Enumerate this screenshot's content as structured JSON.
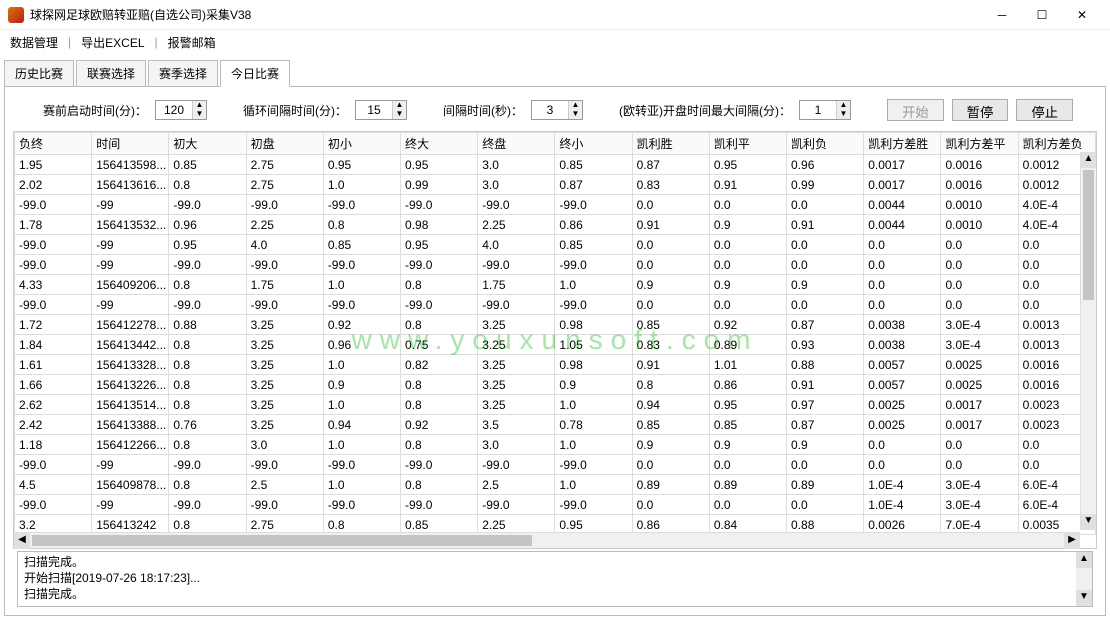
{
  "window": {
    "title": "球探网足球欧赔转亚赔(自选公司)采集V38"
  },
  "menu": {
    "items": [
      "数据管理",
      "导出EXCEL",
      "报警邮箱"
    ]
  },
  "tabs": {
    "items": [
      "历史比赛",
      "联赛选择",
      "赛季选择",
      "今日比赛"
    ],
    "active": 3
  },
  "controls": {
    "label1": "赛前启动时间(分)：",
    "spin1": "120",
    "label2": "循环间隔时间(分)：",
    "spin2": "15",
    "label3": "间隔时间(秒)：",
    "spin3": "3",
    "label4": "(欧转亚)开盘时间最大间隔(分)：",
    "spin4": "1",
    "btn_start": "开始",
    "btn_pause": "暂停",
    "btn_stop": "停止"
  },
  "table": {
    "headers": [
      "负终",
      "时间",
      "初大",
      "初盘",
      "初小",
      "终大",
      "终盘",
      "终小",
      "凯利胜",
      "凯利平",
      "凯利负",
      "凯利方差胜",
      "凯利方差平",
      "凯利方差负"
    ],
    "rows": [
      [
        "1.95",
        "156413598...",
        "0.85",
        "2.75",
        "0.95",
        "0.95",
        "3.0",
        "0.85",
        "0.87",
        "0.95",
        "0.96",
        "0.0017",
        "0.0016",
        "0.0012"
      ],
      [
        "2.02",
        "156413616...",
        "0.8",
        "2.75",
        "1.0",
        "0.99",
        "3.0",
        "0.87",
        "0.83",
        "0.91",
        "0.99",
        "0.0017",
        "0.0016",
        "0.0012"
      ],
      [
        "-99.0",
        "-99",
        "-99.0",
        "-99.0",
        "-99.0",
        "-99.0",
        "-99.0",
        "-99.0",
        "0.0",
        "0.0",
        "0.0",
        "0.0044",
        "0.0010",
        "4.0E-4"
      ],
      [
        "1.78",
        "156413532...",
        "0.96",
        "2.25",
        "0.8",
        "0.98",
        "2.25",
        "0.86",
        "0.91",
        "0.9",
        "0.91",
        "0.0044",
        "0.0010",
        "4.0E-4"
      ],
      [
        "-99.0",
        "-99",
        "0.95",
        "4.0",
        "0.85",
        "0.95",
        "4.0",
        "0.85",
        "0.0",
        "0.0",
        "0.0",
        "0.0",
        "0.0",
        "0.0"
      ],
      [
        "-99.0",
        "-99",
        "-99.0",
        "-99.0",
        "-99.0",
        "-99.0",
        "-99.0",
        "-99.0",
        "0.0",
        "0.0",
        "0.0",
        "0.0",
        "0.0",
        "0.0"
      ],
      [
        "4.33",
        "156409206...",
        "0.8",
        "1.75",
        "1.0",
        "0.8",
        "1.75",
        "1.0",
        "0.9",
        "0.9",
        "0.9",
        "0.0",
        "0.0",
        "0.0"
      ],
      [
        "-99.0",
        "-99",
        "-99.0",
        "-99.0",
        "-99.0",
        "-99.0",
        "-99.0",
        "-99.0",
        "0.0",
        "0.0",
        "0.0",
        "0.0",
        "0.0",
        "0.0"
      ],
      [
        "1.72",
        "156412278...",
        "0.88",
        "3.25",
        "0.92",
        "0.8",
        "3.25",
        "0.98",
        "0.85",
        "0.92",
        "0.87",
        "0.0038",
        "3.0E-4",
        "0.0013"
      ],
      [
        "1.84",
        "156413442...",
        "0.8",
        "3.25",
        "0.96",
        "0.75",
        "3.25",
        "1.05",
        "0.83",
        "0.89",
        "0.93",
        "0.0038",
        "3.0E-4",
        "0.0013"
      ],
      [
        "1.61",
        "156413328...",
        "0.8",
        "3.25",
        "1.0",
        "0.82",
        "3.25",
        "0.98",
        "0.91",
        "1.01",
        "0.88",
        "0.0057",
        "0.0025",
        "0.0016"
      ],
      [
        "1.66",
        "156413226...",
        "0.8",
        "3.25",
        "0.9",
        "0.8",
        "3.25",
        "0.9",
        "0.8",
        "0.86",
        "0.91",
        "0.0057",
        "0.0025",
        "0.0016"
      ],
      [
        "2.62",
        "156413514...",
        "0.8",
        "3.25",
        "1.0",
        "0.8",
        "3.25",
        "1.0",
        "0.94",
        "0.95",
        "0.97",
        "0.0025",
        "0.0017",
        "0.0023"
      ],
      [
        "2.42",
        "156413388...",
        "0.76",
        "3.25",
        "0.94",
        "0.92",
        "3.5",
        "0.78",
        "0.85",
        "0.85",
        "0.87",
        "0.0025",
        "0.0017",
        "0.0023"
      ],
      [
        "1.18",
        "156412266...",
        "0.8",
        "3.0",
        "1.0",
        "0.8",
        "3.0",
        "1.0",
        "0.9",
        "0.9",
        "0.9",
        "0.0",
        "0.0",
        "0.0"
      ],
      [
        "-99.0",
        "-99",
        "-99.0",
        "-99.0",
        "-99.0",
        "-99.0",
        "-99.0",
        "-99.0",
        "0.0",
        "0.0",
        "0.0",
        "0.0",
        "0.0",
        "0.0"
      ],
      [
        "4.5",
        "156409878...",
        "0.8",
        "2.5",
        "1.0",
        "0.8",
        "2.5",
        "1.0",
        "0.89",
        "0.89",
        "0.89",
        "1.0E-4",
        "3.0E-4",
        "6.0E-4"
      ],
      [
        "-99.0",
        "-99",
        "-99.0",
        "-99.0",
        "-99.0",
        "-99.0",
        "-99.0",
        "-99.0",
        "0.0",
        "0.0",
        "0.0",
        "1.0E-4",
        "3.0E-4",
        "6.0E-4"
      ],
      [
        "3.2",
        "156413242",
        "0.8",
        "2.75",
        "0.8",
        "0.85",
        "2.25",
        "0.95",
        "0.86",
        "0.84",
        "0.88",
        "0.0026",
        "7.0E-4",
        "0.0035"
      ]
    ]
  },
  "log": {
    "lines": [
      "扫描完成。",
      "开始扫描[2019-07-26 18:17:23]...",
      "扫描完成。"
    ]
  },
  "watermark": "www.youxunsoft.com"
}
